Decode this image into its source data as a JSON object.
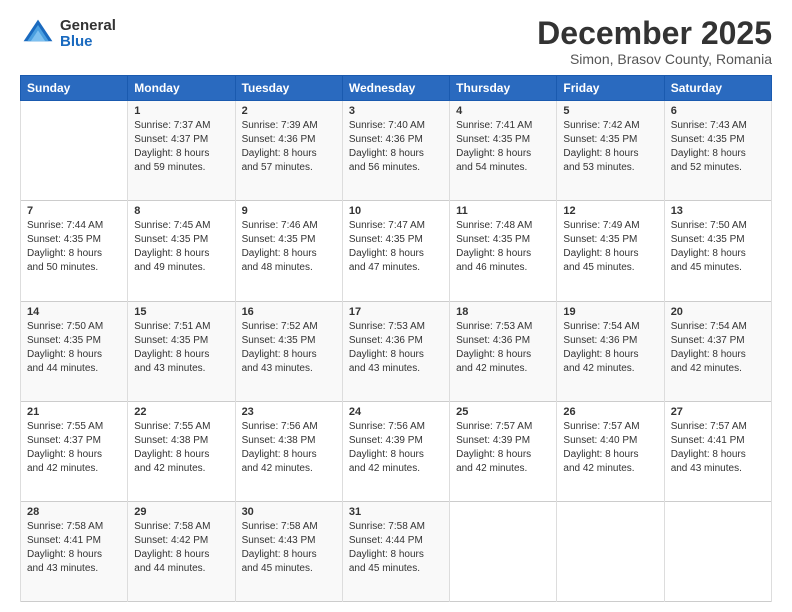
{
  "logo": {
    "general": "General",
    "blue": "Blue"
  },
  "title": "December 2025",
  "location": "Simon, Brasov County, Romania",
  "weekdays": [
    "Sunday",
    "Monday",
    "Tuesday",
    "Wednesday",
    "Thursday",
    "Friday",
    "Saturday"
  ],
  "weeks": [
    [
      {
        "day": "",
        "sunrise": "",
        "sunset": "",
        "daylight": ""
      },
      {
        "day": "1",
        "sunrise": "Sunrise: 7:37 AM",
        "sunset": "Sunset: 4:37 PM",
        "daylight": "Daylight: 8 hours and 59 minutes."
      },
      {
        "day": "2",
        "sunrise": "Sunrise: 7:39 AM",
        "sunset": "Sunset: 4:36 PM",
        "daylight": "Daylight: 8 hours and 57 minutes."
      },
      {
        "day": "3",
        "sunrise": "Sunrise: 7:40 AM",
        "sunset": "Sunset: 4:36 PM",
        "daylight": "Daylight: 8 hours and 56 minutes."
      },
      {
        "day": "4",
        "sunrise": "Sunrise: 7:41 AM",
        "sunset": "Sunset: 4:35 PM",
        "daylight": "Daylight: 8 hours and 54 minutes."
      },
      {
        "day": "5",
        "sunrise": "Sunrise: 7:42 AM",
        "sunset": "Sunset: 4:35 PM",
        "daylight": "Daylight: 8 hours and 53 minutes."
      },
      {
        "day": "6",
        "sunrise": "Sunrise: 7:43 AM",
        "sunset": "Sunset: 4:35 PM",
        "daylight": "Daylight: 8 hours and 52 minutes."
      }
    ],
    [
      {
        "day": "7",
        "sunrise": "Sunrise: 7:44 AM",
        "sunset": "Sunset: 4:35 PM",
        "daylight": "Daylight: 8 hours and 50 minutes."
      },
      {
        "day": "8",
        "sunrise": "Sunrise: 7:45 AM",
        "sunset": "Sunset: 4:35 PM",
        "daylight": "Daylight: 8 hours and 49 minutes."
      },
      {
        "day": "9",
        "sunrise": "Sunrise: 7:46 AM",
        "sunset": "Sunset: 4:35 PM",
        "daylight": "Daylight: 8 hours and 48 minutes."
      },
      {
        "day": "10",
        "sunrise": "Sunrise: 7:47 AM",
        "sunset": "Sunset: 4:35 PM",
        "daylight": "Daylight: 8 hours and 47 minutes."
      },
      {
        "day": "11",
        "sunrise": "Sunrise: 7:48 AM",
        "sunset": "Sunset: 4:35 PM",
        "daylight": "Daylight: 8 hours and 46 minutes."
      },
      {
        "day": "12",
        "sunrise": "Sunrise: 7:49 AM",
        "sunset": "Sunset: 4:35 PM",
        "daylight": "Daylight: 8 hours and 45 minutes."
      },
      {
        "day": "13",
        "sunrise": "Sunrise: 7:50 AM",
        "sunset": "Sunset: 4:35 PM",
        "daylight": "Daylight: 8 hours and 45 minutes."
      }
    ],
    [
      {
        "day": "14",
        "sunrise": "Sunrise: 7:50 AM",
        "sunset": "Sunset: 4:35 PM",
        "daylight": "Daylight: 8 hours and 44 minutes."
      },
      {
        "day": "15",
        "sunrise": "Sunrise: 7:51 AM",
        "sunset": "Sunset: 4:35 PM",
        "daylight": "Daylight: 8 hours and 43 minutes."
      },
      {
        "day": "16",
        "sunrise": "Sunrise: 7:52 AM",
        "sunset": "Sunset: 4:35 PM",
        "daylight": "Daylight: 8 hours and 43 minutes."
      },
      {
        "day": "17",
        "sunrise": "Sunrise: 7:53 AM",
        "sunset": "Sunset: 4:36 PM",
        "daylight": "Daylight: 8 hours and 43 minutes."
      },
      {
        "day": "18",
        "sunrise": "Sunrise: 7:53 AM",
        "sunset": "Sunset: 4:36 PM",
        "daylight": "Daylight: 8 hours and 42 minutes."
      },
      {
        "day": "19",
        "sunrise": "Sunrise: 7:54 AM",
        "sunset": "Sunset: 4:36 PM",
        "daylight": "Daylight: 8 hours and 42 minutes."
      },
      {
        "day": "20",
        "sunrise": "Sunrise: 7:54 AM",
        "sunset": "Sunset: 4:37 PM",
        "daylight": "Daylight: 8 hours and 42 minutes."
      }
    ],
    [
      {
        "day": "21",
        "sunrise": "Sunrise: 7:55 AM",
        "sunset": "Sunset: 4:37 PM",
        "daylight": "Daylight: 8 hours and 42 minutes."
      },
      {
        "day": "22",
        "sunrise": "Sunrise: 7:55 AM",
        "sunset": "Sunset: 4:38 PM",
        "daylight": "Daylight: 8 hours and 42 minutes."
      },
      {
        "day": "23",
        "sunrise": "Sunrise: 7:56 AM",
        "sunset": "Sunset: 4:38 PM",
        "daylight": "Daylight: 8 hours and 42 minutes."
      },
      {
        "day": "24",
        "sunrise": "Sunrise: 7:56 AM",
        "sunset": "Sunset: 4:39 PM",
        "daylight": "Daylight: 8 hours and 42 minutes."
      },
      {
        "day": "25",
        "sunrise": "Sunrise: 7:57 AM",
        "sunset": "Sunset: 4:39 PM",
        "daylight": "Daylight: 8 hours and 42 minutes."
      },
      {
        "day": "26",
        "sunrise": "Sunrise: 7:57 AM",
        "sunset": "Sunset: 4:40 PM",
        "daylight": "Daylight: 8 hours and 42 minutes."
      },
      {
        "day": "27",
        "sunrise": "Sunrise: 7:57 AM",
        "sunset": "Sunset: 4:41 PM",
        "daylight": "Daylight: 8 hours and 43 minutes."
      }
    ],
    [
      {
        "day": "28",
        "sunrise": "Sunrise: 7:58 AM",
        "sunset": "Sunset: 4:41 PM",
        "daylight": "Daylight: 8 hours and 43 minutes."
      },
      {
        "day": "29",
        "sunrise": "Sunrise: 7:58 AM",
        "sunset": "Sunset: 4:42 PM",
        "daylight": "Daylight: 8 hours and 44 minutes."
      },
      {
        "day": "30",
        "sunrise": "Sunrise: 7:58 AM",
        "sunset": "Sunset: 4:43 PM",
        "daylight": "Daylight: 8 hours and 45 minutes."
      },
      {
        "day": "31",
        "sunrise": "Sunrise: 7:58 AM",
        "sunset": "Sunset: 4:44 PM",
        "daylight": "Daylight: 8 hours and 45 minutes."
      },
      {
        "day": "",
        "sunrise": "",
        "sunset": "",
        "daylight": ""
      },
      {
        "day": "",
        "sunrise": "",
        "sunset": "",
        "daylight": ""
      },
      {
        "day": "",
        "sunrise": "",
        "sunset": "",
        "daylight": ""
      }
    ]
  ]
}
